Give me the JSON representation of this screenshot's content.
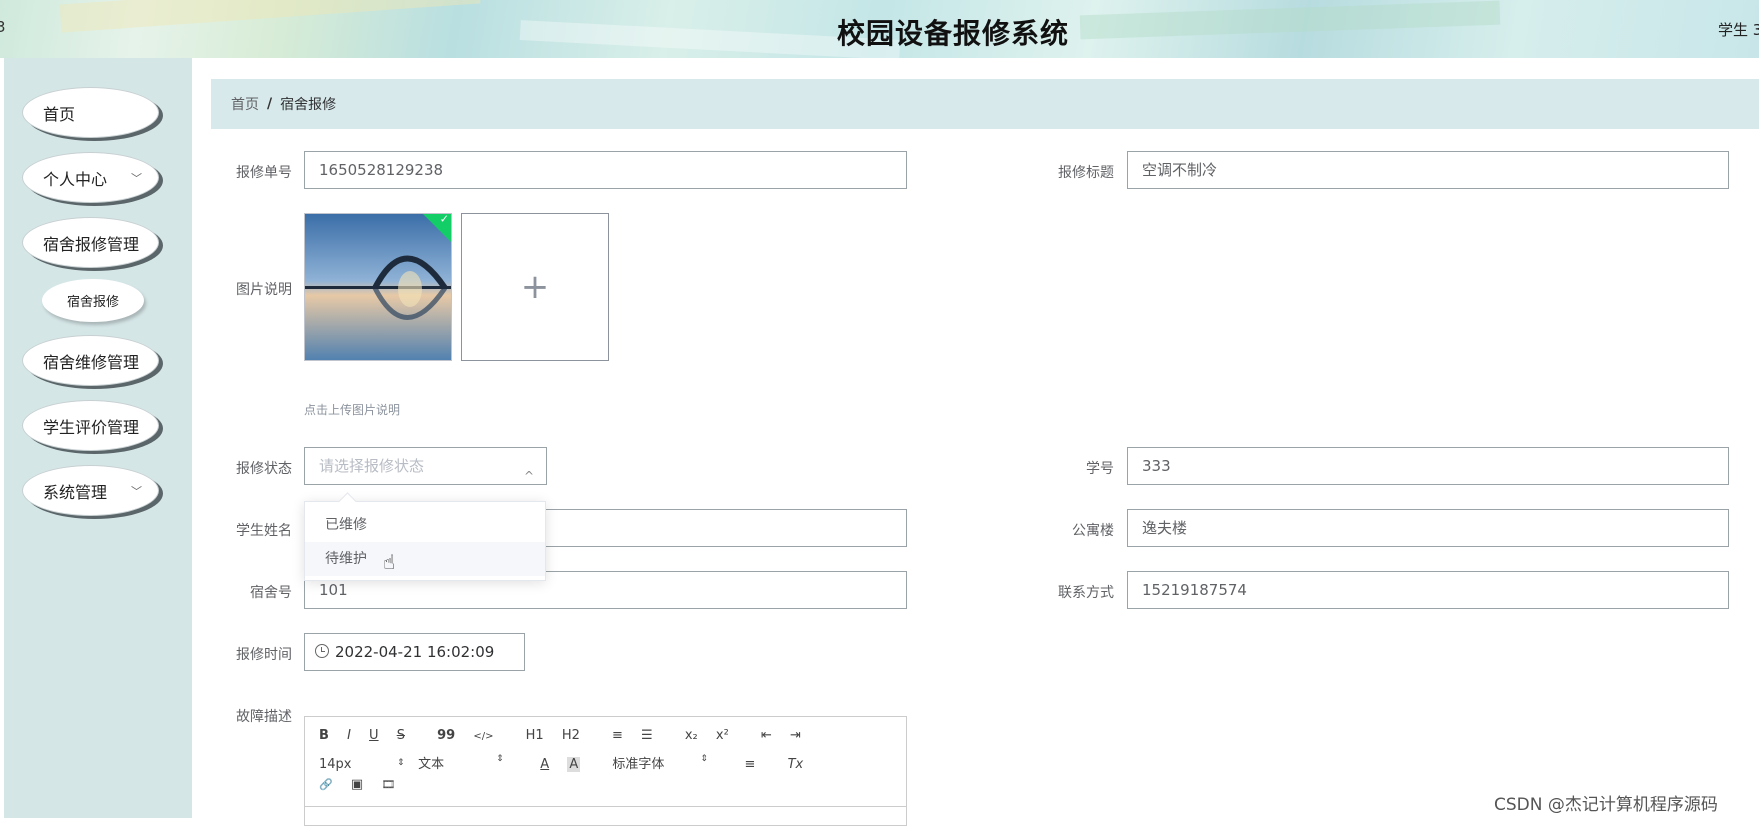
{
  "header": {
    "left_mark": "3",
    "title": "校园设备报修系统",
    "user": "学生 3"
  },
  "sidebar": {
    "items": [
      {
        "label": "首页"
      },
      {
        "label": "个人中心",
        "chevron": "chevron-down-icon"
      },
      {
        "label": "宿舍报修管理"
      },
      {
        "label": "宿舍维修管理"
      },
      {
        "label": "学生评价管理"
      },
      {
        "label": "系统管理",
        "chevron": "chevron-down-icon"
      }
    ],
    "sub_item": "宿舍报修",
    "chevron_glyph": "﹀"
  },
  "breadcrumb": {
    "home": "首页",
    "separator": "/",
    "current": "宿舍报修"
  },
  "form": {
    "order_no": {
      "label": "报修单号",
      "value": "1650528129238"
    },
    "title": {
      "label": "报修标题",
      "value": "空调不制冷"
    },
    "image": {
      "label": "图片说明",
      "tip": "点击上传图片说明",
      "add_glyph": "+",
      "check_glyph": "✓"
    },
    "status": {
      "label": "报修状态",
      "placeholder": "请选择报修状态",
      "arrow": "^",
      "options": [
        "已维修",
        "待维护"
      ]
    },
    "student_no": {
      "label": "学号",
      "value": "333"
    },
    "student_name": {
      "label": "学生姓名",
      "value": ""
    },
    "building": {
      "label": "公寓楼",
      "value": "逸夫楼"
    },
    "room": {
      "label": "宿舍号",
      "value": "101"
    },
    "contact": {
      "label": "联系方式",
      "value": "15219187574"
    },
    "time": {
      "label": "报修时间",
      "value": "2022-04-21 16:02:09"
    },
    "description": {
      "label": "故障描述"
    }
  },
  "editor": {
    "row1": [
      "B",
      "I",
      "U",
      "S",
      "99",
      "</>",
      "H1",
      "H2",
      "≡",
      "☰",
      "x₂",
      "x²",
      "⇤",
      "⇥"
    ],
    "row2": {
      "size": "14px",
      "text": "文本",
      "font": "标准字体",
      "color": "A",
      "bg": "A",
      "align": "≡",
      "clear": "Tx",
      "arrow": "⇕"
    },
    "row3": [
      "🔗",
      "▣",
      "🎞"
    ]
  },
  "cursor": "☝",
  "watermark": "CSDN @杰记计算机程序源码",
  "colors": {
    "sidebar_bg": "#d5e6e7",
    "breadcrumb_bg": "#d8e9ec",
    "success": "#13ce66"
  }
}
